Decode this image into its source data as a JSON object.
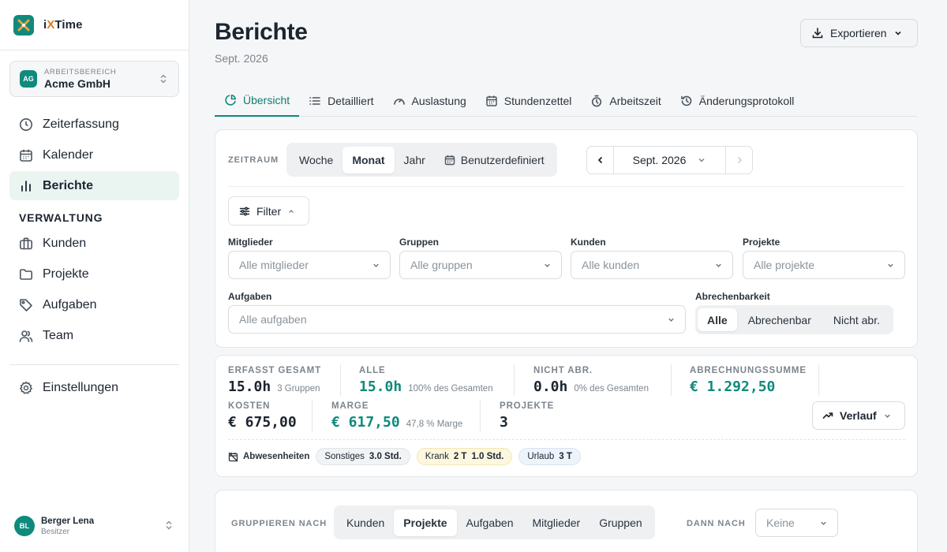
{
  "app": {
    "name_prefix": "i",
    "name_x": "X",
    "name_suffix": "Time"
  },
  "workspace": {
    "label": "ARBEITSBEREICH",
    "name": "Acme GmbH",
    "initials": "AG"
  },
  "nav": {
    "main": [
      {
        "label": "Zeiterfassung",
        "icon": "clock-icon",
        "active": false
      },
      {
        "label": "Kalender",
        "icon": "calendar-icon",
        "active": false
      },
      {
        "label": "Berichte",
        "icon": "bar-chart-icon",
        "active": true
      }
    ],
    "section_title": "VERWALTUNG",
    "admin": [
      {
        "label": "Kunden",
        "icon": "briefcase-icon"
      },
      {
        "label": "Projekte",
        "icon": "folder-icon"
      },
      {
        "label": "Aufgaben",
        "icon": "tag-icon"
      },
      {
        "label": "Team",
        "icon": "users-icon"
      }
    ],
    "settings": {
      "label": "Einstellungen",
      "icon": "gear-icon"
    }
  },
  "user": {
    "name": "Berger Lena",
    "role": "Besitzer",
    "initials": "BL"
  },
  "page": {
    "title": "Berichte",
    "subtitle": "Sept. 2026",
    "export_label": "Exportieren"
  },
  "tabs": [
    {
      "label": "Übersicht",
      "active": true
    },
    {
      "label": "Detailliert"
    },
    {
      "label": "Auslastung"
    },
    {
      "label": "Stundenzettel"
    },
    {
      "label": "Arbeitszeit"
    },
    {
      "label": "Änderungsprotokoll"
    }
  ],
  "filters": {
    "period_label": "ZEITRAUM",
    "period_options": [
      "Woche",
      "Monat",
      "Jahr",
      "Benutzerdefiniert"
    ],
    "period_selected": "Monat",
    "period_value": "Sept. 2026",
    "filter_button": "Filter",
    "members": {
      "label": "Mitglieder",
      "placeholder": "Alle mitglieder"
    },
    "groups": {
      "label": "Gruppen",
      "placeholder": "Alle gruppen"
    },
    "clients": {
      "label": "Kunden",
      "placeholder": "Alle kunden"
    },
    "projects": {
      "label": "Projekte",
      "placeholder": "Alle projekte"
    },
    "tasks": {
      "label": "Aufgaben",
      "placeholder": "Alle aufgaben"
    },
    "billable": {
      "label": "Abrechenbarkeit",
      "options": [
        "Alle",
        "Abrechenbar",
        "Nicht abr."
      ],
      "selected": "Alle"
    }
  },
  "stats": {
    "total": {
      "label": "ERFASST GESAMT",
      "value": "15.0h",
      "sub": "3 Gruppen"
    },
    "all": {
      "label": "ALLE",
      "value": "15.0h",
      "sub": "100% des Gesamten"
    },
    "nonbillable": {
      "label": "NICHT ABR.",
      "value": "0.0h",
      "sub": "0% des Gesamten"
    },
    "billing_sum": {
      "label": "ABRECHNUNGSSUMME",
      "value": "€ 1.292,50"
    },
    "costs": {
      "label": "KOSTEN",
      "value": "€ 675,00"
    },
    "margin": {
      "label": "MARGE",
      "value": "€ 617,50",
      "sub": "47,8 % Marge"
    },
    "projects": {
      "label": "PROJEKTE",
      "value": "3"
    },
    "trend_button": "Verlauf",
    "colors": {
      "accent": "#0f8a7c"
    }
  },
  "absences": {
    "label": "Abwesenheiten",
    "items": [
      {
        "name": "Sonstiges",
        "value": "3.0 Std.",
        "extra": "",
        "color": "grey"
      },
      {
        "name": "Krank",
        "value": "2 T",
        "extra": "1.0 Std.",
        "color": "yellow"
      },
      {
        "name": "Urlaub",
        "value": "3 T",
        "extra": "",
        "color": "blue"
      }
    ]
  },
  "grouping": {
    "label": "GRUPPIEREN NACH",
    "options": [
      "Kunden",
      "Projekte",
      "Aufgaben",
      "Mitglieder",
      "Gruppen"
    ],
    "selected": "Projekte",
    "then_label": "DANN NACH",
    "then_value": "Keine"
  }
}
